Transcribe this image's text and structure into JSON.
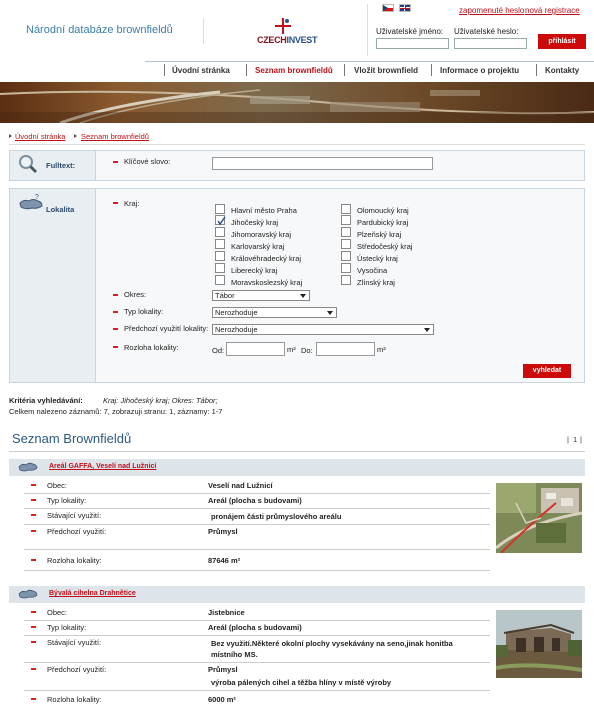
{
  "header": {
    "site_title": "Národní databáze brownfieldů",
    "logo_text_a": "CZECH",
    "logo_text_b": "INVEST",
    "forgot_password": "zapomenuté heslo",
    "new_registration": "nová registrace",
    "username_label": "Uživatelské jméno:",
    "password_label": "Uživatelské heslo:",
    "login_button": "přihlásit"
  },
  "nav": {
    "items": [
      "Úvodní stránka",
      "Seznam brownfieldů",
      "Vložit brownfield",
      "Informace o projektu",
      "Kontakty"
    ]
  },
  "breadcrumb": [
    "Úvodní stránka",
    "Seznam brownfieldů"
  ],
  "search": {
    "fulltext_title": "Fulltext:",
    "keyword_label": "Klíčové slovo:",
    "locality_title": "Lokalita",
    "region_label": "Kraj:",
    "regions_col1": [
      "Hlavní město Praha",
      "Jihočeský kraj",
      "Jihomoravský kraj",
      "Karlovarský kraj",
      "Královéhradecký kraj",
      "Liberecký kraj",
      "Moravskoslezský kraj"
    ],
    "regions_col2": [
      "Olomoucký kraj",
      "Pardubický kraj",
      "Plzeňský kraj",
      "Středočeský kraj",
      "Ústecký kraj",
      "Vysočina",
      "Zlínský kraj"
    ],
    "checked_region": "Jihočeský kraj",
    "district_label": "Okres:",
    "district_value": "Tábor",
    "type_label": "Typ lokality:",
    "type_value": "Nerozhoduje",
    "prev_use_label": "Předchozí využití lokality:",
    "prev_use_value": "Nerozhoduje",
    "size_label": "Rozloha lokality:",
    "from_label": "Od:",
    "to_label": "Do:",
    "unit": "m²",
    "search_button": "vyhledat"
  },
  "criteria": {
    "label": "Kritéria vyhledávání:",
    "text": "Kraj: Jihočeský kraj; Okres: Tábor;",
    "summary": "Celkem nalezeno záznamů: 7, zobrazuji stranu: 1, záznamy: 1-7"
  },
  "list": {
    "title": "Seznam Brownfieldů",
    "pager_sep": "|",
    "page": "1",
    "items": [
      {
        "name": "Areál GAFFA, Veselí nad Lužnicí",
        "rows": [
          {
            "label": "Obec:",
            "value": "Veselí nad Lužnicí"
          },
          {
            "label": "Typ lokality:",
            "value": "Areál (plocha s budovami)"
          },
          {
            "label": "Stávající využití:",
            "value": "pronájem části průmyslového areálu"
          },
          {
            "label": "Předchozí využití:",
            "value": "Průmysl"
          },
          {
            "label": "Rozloha lokality:",
            "value": "87646 m²"
          }
        ]
      },
      {
        "name": "Bývalá cihelna Drahnětice",
        "rows": [
          {
            "label": "Obec:",
            "value": "Jistebnice"
          },
          {
            "label": "Typ lokality:",
            "value": "Areál (plocha s budovami)"
          },
          {
            "label": "Stávající využití:",
            "value": "Bez využití.Některé okolní plochy vysekávány na seno,jinak honitba místního MS."
          },
          {
            "label": "Předchozí využití:",
            "value": "Průmysl",
            "value2": "výroba pálených cihel a těžba hlíny v místě výroby"
          },
          {
            "label": "Rozloha lokality:",
            "value": "6000 m²"
          }
        ]
      }
    ]
  }
}
